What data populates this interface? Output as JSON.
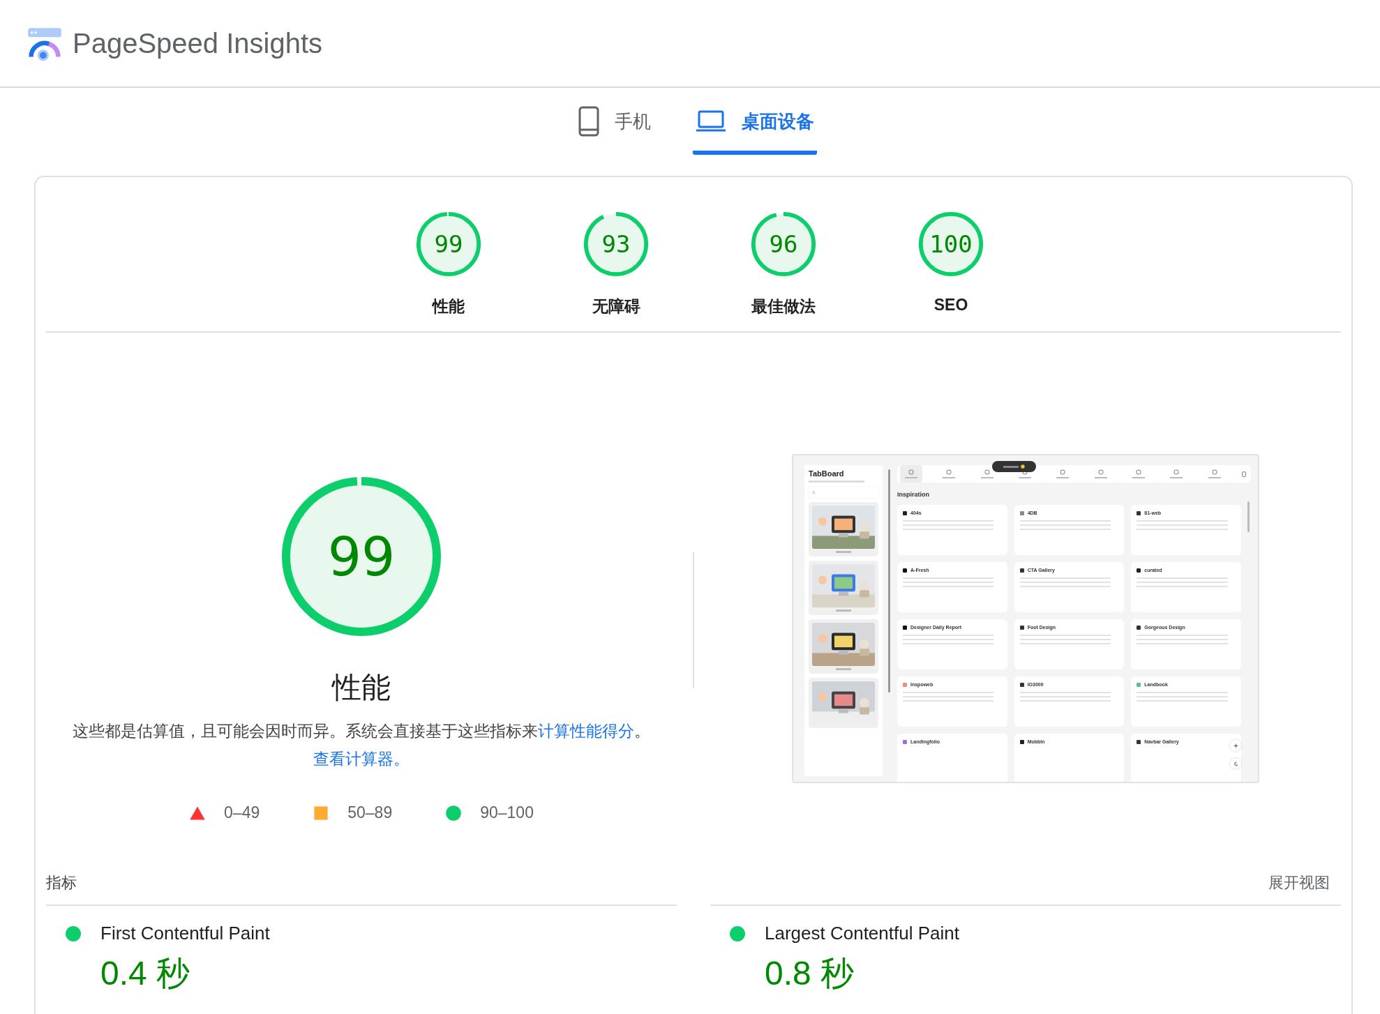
{
  "header": {
    "title": "PageSpeed Insights"
  },
  "tabs": [
    {
      "label": "手机",
      "kind": "mobile",
      "selected": false
    },
    {
      "label": "桌面设备",
      "kind": "desktop",
      "selected": true
    }
  ],
  "categories": [
    {
      "score": "99",
      "level": 0.99,
      "label": "性能"
    },
    {
      "score": "93",
      "level": 0.93,
      "label": "无障碍"
    },
    {
      "score": "96",
      "level": 0.96,
      "label": "最佳做法"
    },
    {
      "score": "100",
      "level": 1,
      "label": "SEO"
    }
  ],
  "performance": {
    "score": "99",
    "level": 0.99,
    "title": "性能",
    "description": [
      {
        "kind": "text",
        "text": "这些都是估算值，且可能会因时而异。系统会直接基于这些指标来"
      },
      {
        "kind": "link",
        "text": "计算性能得分"
      },
      {
        "kind": "text",
        "text": "。"
      },
      {
        "kind": "link",
        "text": "查看计算器。"
      }
    ]
  },
  "legend": [
    {
      "kind": "triangle",
      "range": "0–49",
      "color": "#ff3333"
    },
    {
      "kind": "square",
      "range": "50–89",
      "color": "#ffaa33"
    },
    {
      "kind": "circle",
      "range": "90–100",
      "color": "#0cce6b"
    }
  ],
  "preview": {
    "kind": "screenshot",
    "app": {
      "name": "TabBoard",
      "nav": [
        {
          "selected": true
        },
        {
          "selected": false
        },
        {
          "selected": false
        },
        {
          "selected": false
        },
        {
          "selected": false
        },
        {
          "selected": false
        },
        {
          "selected": false
        },
        {
          "selected": false
        },
        {
          "selected": false
        }
      ],
      "section": "Inspiration",
      "sites": [
        {
          "title": "404s",
          "color": "#222222",
          "has_description": true
        },
        {
          "title": "4DB",
          "color": "#888888",
          "has_description": true
        },
        {
          "title": "81-web",
          "color": "#333333",
          "has_description": true
        },
        {
          "title": "A-Fresh",
          "color": "#111111",
          "has_description": true
        },
        {
          "title": "CTA Gallery",
          "color": "#333333",
          "has_description": true
        },
        {
          "title": "curated",
          "color": "#222222",
          "has_description": true
        },
        {
          "title": "Designer Daily Report",
          "color": "#111111",
          "has_description": true
        },
        {
          "title": "Foot Design",
          "color": "#333333",
          "has_description": true
        },
        {
          "title": "Gorgeous Design",
          "color": "#333333",
          "has_description": true
        },
        {
          "title": "Inspoweb",
          "color": "#f28b82",
          "has_description": true
        },
        {
          "title": "IO3000",
          "color": "#333333",
          "has_description": true
        },
        {
          "title": "Landbook",
          "color": "#5fb8a8",
          "has_description": true
        },
        {
          "title": "Landingfolio",
          "color": "#9b6fe0",
          "has_description": false
        },
        {
          "title": "Mobbin",
          "color": "#222222",
          "has_description": false
        },
        {
          "title": "Navbar Gallery",
          "color": "#333333",
          "has_description": false
        }
      ]
    }
  },
  "metrics": {
    "title": "指标",
    "toggle": "展开视图",
    "items": [
      {
        "name": "First Contentful Paint",
        "value": "0.4 秒",
        "color": "#0cce6b"
      },
      {
        "name": "Largest Contentful Paint",
        "value": "0.8 秒",
        "color": "#0cce6b"
      }
    ]
  }
}
